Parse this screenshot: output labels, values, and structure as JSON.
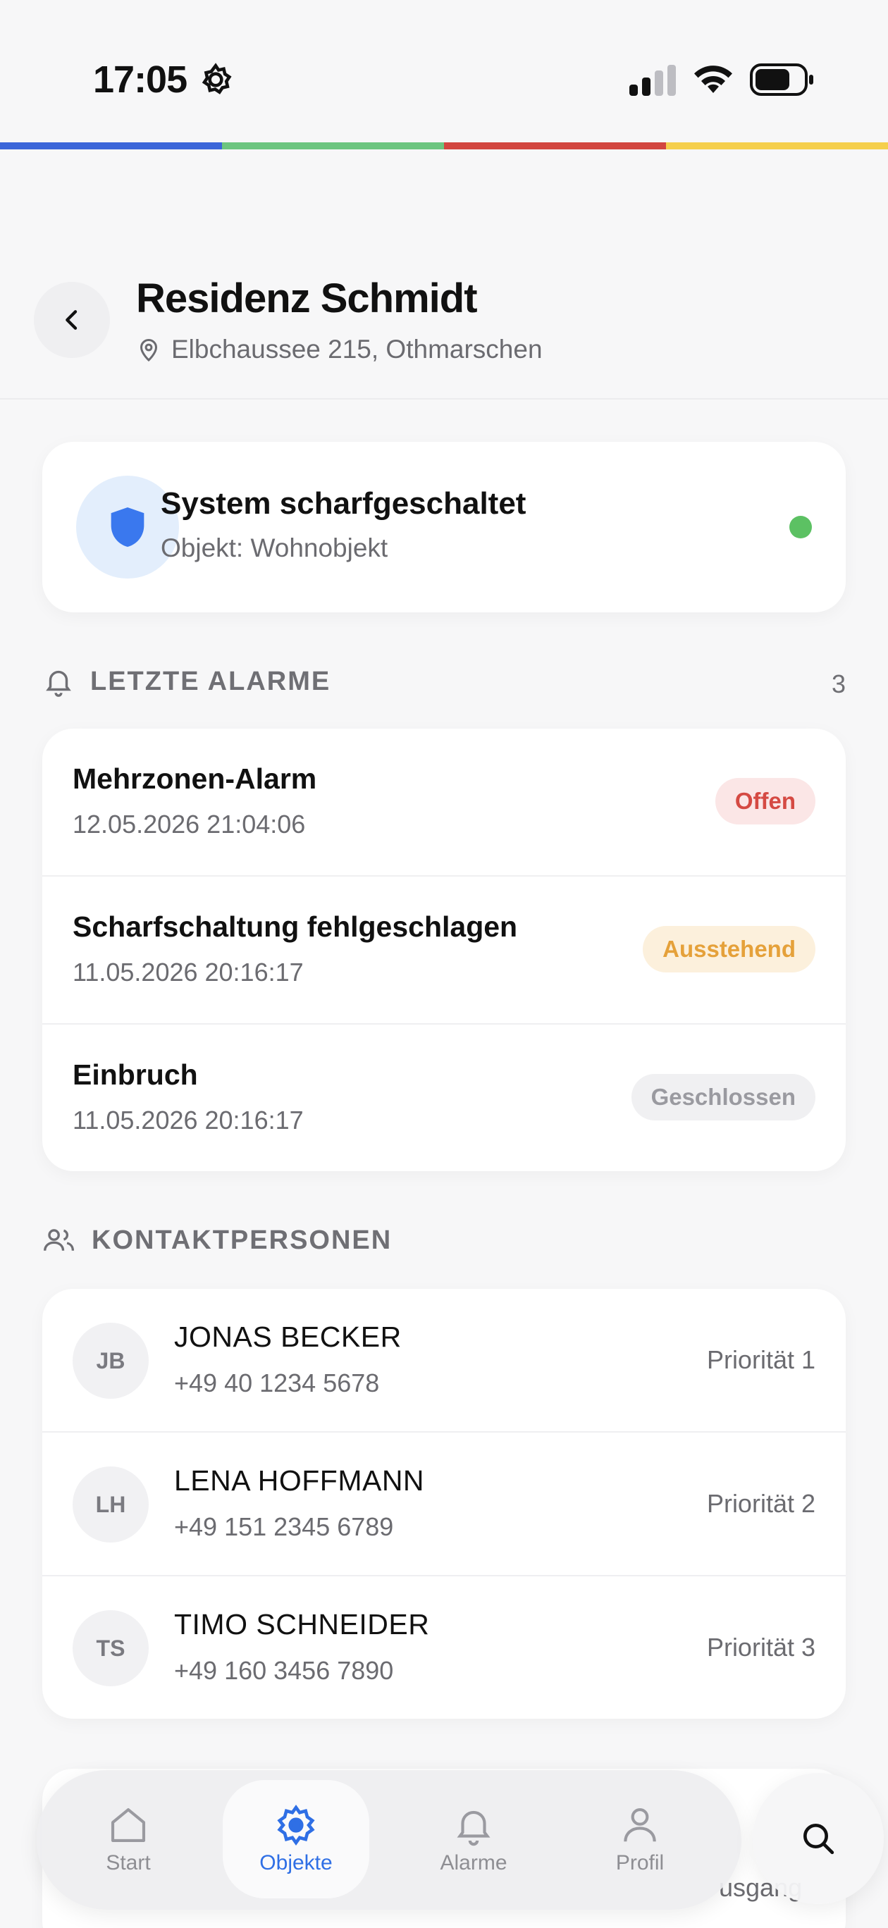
{
  "status_bar": {
    "time": "17:05"
  },
  "brand_strip": {
    "colors": [
      "#3b66d9",
      "#6cc57f",
      "#d2463f",
      "#f5cf4c"
    ]
  },
  "header": {
    "title": "Residenz Schmidt",
    "address": "Elbchaussee 215, Othmarschen"
  },
  "system": {
    "title": "System scharfgeschaltet",
    "subtitle": "Objekt: Wohnobjekt",
    "status_color": "#5cc163"
  },
  "alarms": {
    "heading": "LETZTE ALARME",
    "count": "3",
    "items": [
      {
        "title": "Mehrzonen-Alarm",
        "date": "12.05.2026 21:04:06",
        "status": "Offen"
      },
      {
        "title": "Scharfschaltung fehlgeschlagen",
        "date": "11.05.2026 20:16:17",
        "status": "Ausstehend"
      },
      {
        "title": "Einbruch",
        "date": "11.05.2026 20:16:17",
        "status": "Geschlossen"
      }
    ]
  },
  "contacts": {
    "heading": "KONTAKTPERSONEN",
    "items": [
      {
        "initials": "JB",
        "name": "JONAS BECKER",
        "phone": "+49 40 1234 5678",
        "priority": "Priorität 1"
      },
      {
        "initials": "LH",
        "name": "LENA HOFFMANN",
        "phone": "+49 151 2345 6789",
        "priority": "Priorität 2"
      },
      {
        "initials": "TS",
        "name": "TIMO SCHNEIDER",
        "phone": "+49 160 3456 7890",
        "priority": "Priorität 3"
      }
    ]
  },
  "next_section_peek": "usgang",
  "tabs": [
    {
      "label": "Start",
      "icon": "home-icon"
    },
    {
      "label": "Objekte",
      "icon": "gear-icon",
      "active": true
    },
    {
      "label": "Alarme",
      "icon": "bell-icon"
    },
    {
      "label": "Profil",
      "icon": "person-icon"
    }
  ]
}
